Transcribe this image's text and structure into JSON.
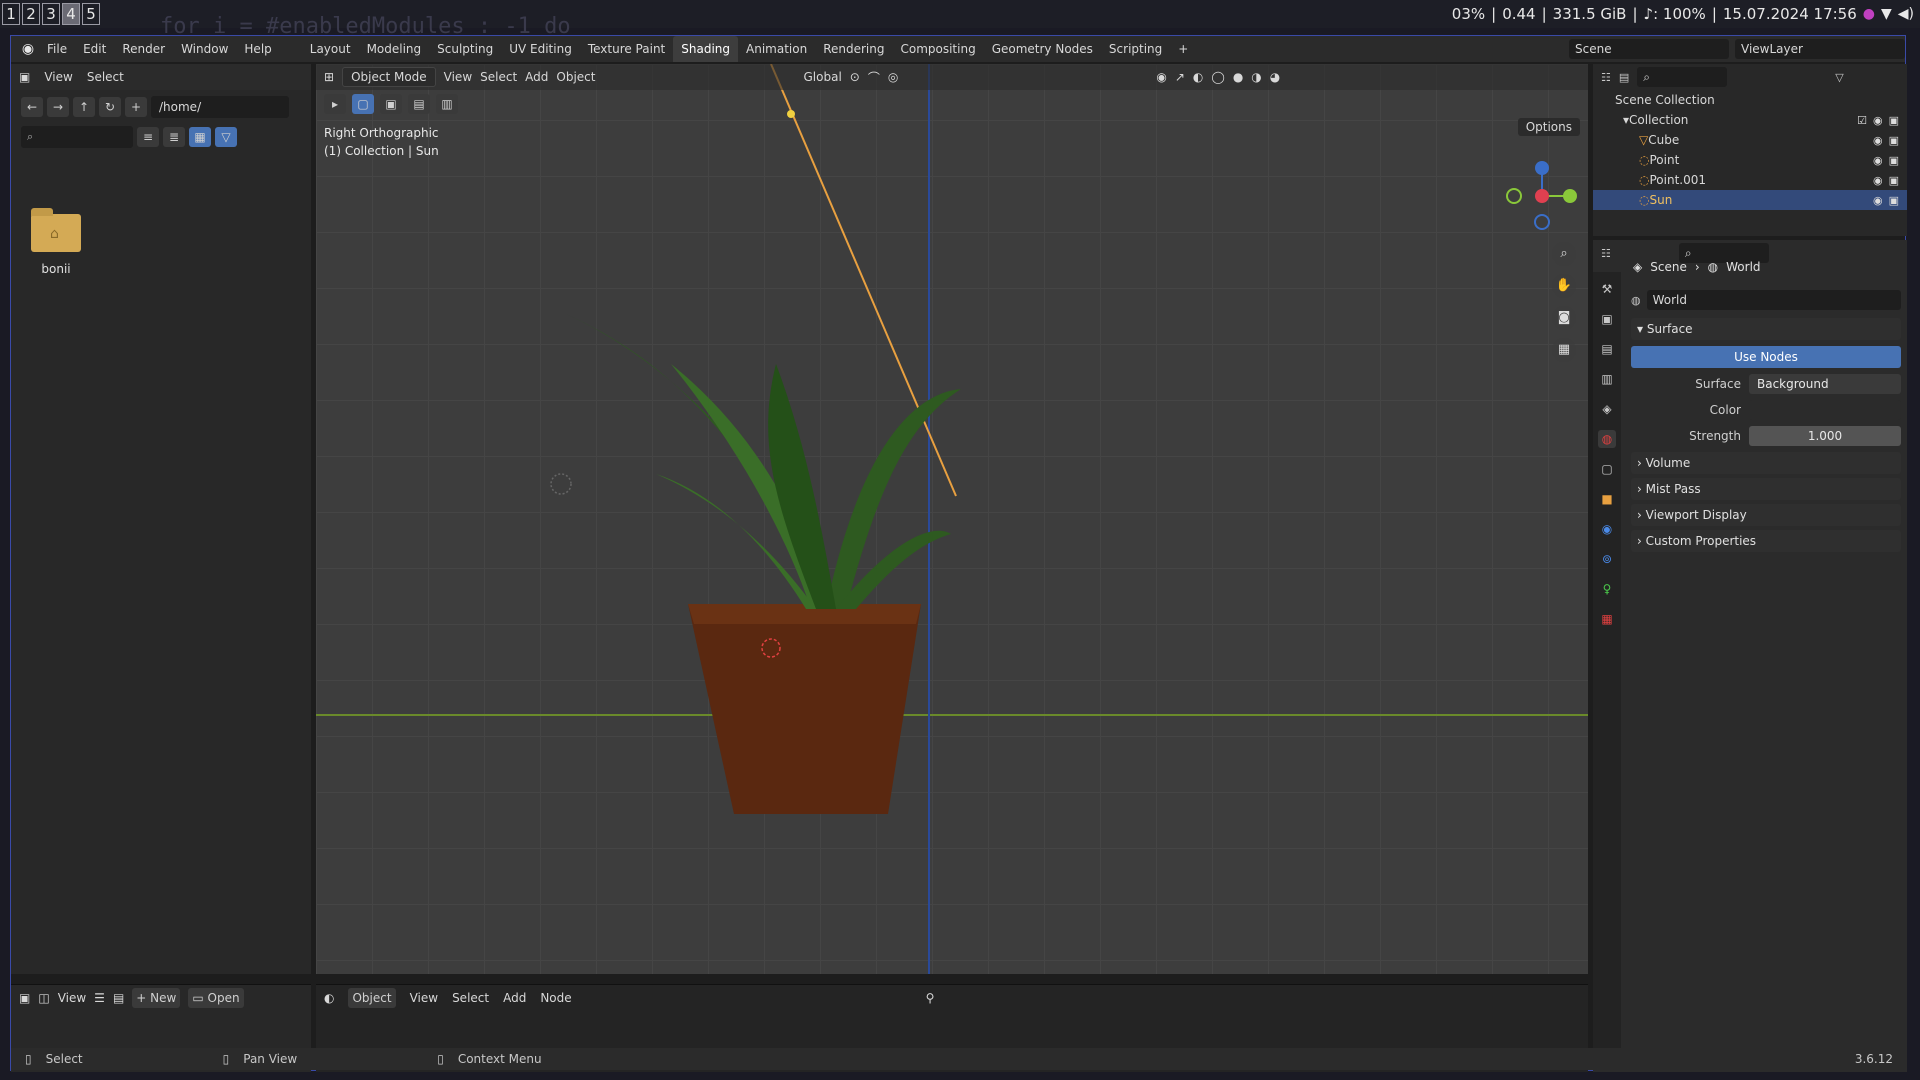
{
  "system": {
    "workspaces": [
      "1",
      "2",
      "3",
      "4",
      "5"
    ],
    "active_workspace": "4",
    "bg_code": "for i = #enabledModules : -1 do",
    "cpu": "03%",
    "load": "0.44",
    "disk": "331.5 GiB",
    "volume": "♪: 100%",
    "datetime": "15.07.2024 17:56"
  },
  "topbar": {
    "menu": [
      "File",
      "Edit",
      "Render",
      "Window",
      "Help"
    ],
    "workspace_tabs": [
      "Layout",
      "Modeling",
      "Sculpting",
      "UV Editing",
      "Texture Paint",
      "Shading",
      "Animation",
      "Rendering",
      "Compositing",
      "Geometry Nodes",
      "Scripting"
    ],
    "active_tab": "Shading",
    "add_tab": "+",
    "scene": "Scene",
    "view_layer": "ViewLayer"
  },
  "filebrowser": {
    "menu": [
      "View",
      "Select"
    ],
    "path": "/home/",
    "folder_name": "bonii",
    "bottom_menu": [
      "View"
    ],
    "new_label": "New",
    "open_label": "Open"
  },
  "viewport": {
    "mode": "Object Mode",
    "menu": [
      "View",
      "Select",
      "Add",
      "Object"
    ],
    "orientation": "Global",
    "view_name": "Right Orthographic",
    "collection_info": "(1) Collection | Sun",
    "options": "Options"
  },
  "node_editor": {
    "mode": "Object",
    "menu": [
      "View",
      "Select",
      "Add",
      "Node"
    ]
  },
  "outliner": {
    "root": "Scene Collection",
    "collection": "Collection",
    "items": [
      {
        "label": "Cube",
        "icon": "mesh-icon"
      },
      {
        "label": "Point",
        "icon": "light-icon"
      },
      {
        "label": "Point.001",
        "icon": "light-icon"
      },
      {
        "label": "Sun",
        "icon": "light-icon"
      }
    ],
    "selected": "Sun"
  },
  "properties": {
    "breadcrumb": [
      "Scene",
      "World"
    ],
    "world_name": "World",
    "surface_section": "Surface",
    "use_nodes": "Use Nodes",
    "surface_label": "Surface",
    "surface_value": "Background",
    "color_label": "Color",
    "strength_label": "Strength",
    "strength_value": "1.000",
    "sections": [
      "Volume",
      "Mist Pass",
      "Viewport Display",
      "Custom Properties"
    ]
  },
  "statusbar": {
    "select": "Select",
    "pan": "Pan View",
    "context": "Context Menu",
    "version": "3.6.12"
  },
  "colors": {
    "accent": "#4772b3",
    "pot": "#5a2810",
    "leaf": "#2e5a20",
    "sun_line": "#e8a040"
  }
}
